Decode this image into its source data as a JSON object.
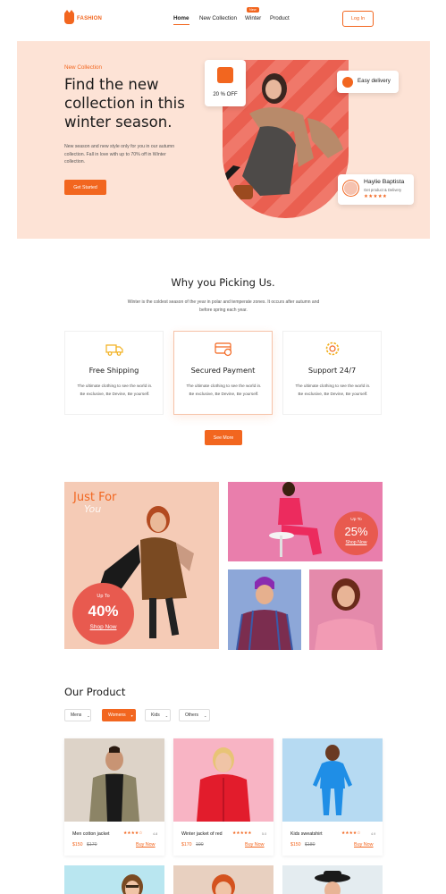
{
  "nav": {
    "logo": "FASHION",
    "links": [
      "Home",
      "New Collection",
      "Winter",
      "Product"
    ],
    "new_badge": "New",
    "login": "Log In"
  },
  "hero": {
    "kicker": "New Collection",
    "title": "Find the new collection in this winter season.",
    "description": "New season and new style only for you in our autumn collection. Fall in love with up to 70% off in Winter collection.",
    "cta": "Get Started",
    "discount": "20 % OFF",
    "delivery": "Easy delivery",
    "review": {
      "name": "Haylie Baptista",
      "subtitle": "Get product & Delivery",
      "stars": "★★★★★"
    }
  },
  "why": {
    "title": "Why you Picking Us.",
    "description": "Winter is the coldest season of the year in polar and temperate zones. It occurs after autumn and before spring each year.",
    "features": [
      {
        "title": "Free Shipping",
        "desc": "The ultimate clothing to see the world in. Be exclusive, Be Devine, Be yourself.",
        "icon": "truck-icon"
      },
      {
        "title": "Secured Payment",
        "desc": "The ultimate clothing to see the world in. Be exclusive, Be Devine, Be yourself.",
        "icon": "credit-card-icon"
      },
      {
        "title": "Support 24/7",
        "desc": "The ultimate clothing to see the world in. Be exclusive, Be Devine, Be yourself.",
        "icon": "support-gear-icon"
      }
    ],
    "see_more": "See More"
  },
  "promo": {
    "title": "Just For",
    "title_overlay": "You",
    "main_upto": "Up To",
    "main_value": "40%",
    "main_link": "Shop Now",
    "side_upto": "Up To",
    "side_value": "25%",
    "side_link": "Shop Now"
  },
  "products": {
    "title": "Our Product",
    "filters": [
      "Mens",
      "Womens",
      "Kids",
      "Others"
    ],
    "items": [
      {
        "name": "Men cotton jacket",
        "stars": "★★★★☆",
        "rating": "4.8",
        "price": "$150",
        "old_price": "$170",
        "buy": "Buy Now"
      },
      {
        "name": "Winter jacket of red",
        "stars": "★★★★★",
        "rating": "5.0",
        "price": "$170",
        "old_price": "190",
        "buy": "Buy Now"
      },
      {
        "name": "Kids sweatshirt",
        "stars": "★★★★☆",
        "rating": "4.9",
        "price": "$150",
        "old_price": "$180",
        "buy": "Buy Now"
      }
    ]
  },
  "colors": {
    "accent": "#f2661f",
    "hero_bg": "#fde3d6",
    "promo_peach": "#f5cbb6",
    "promo_pink": "#e97eac",
    "promo_blue": "#8da7d8"
  }
}
